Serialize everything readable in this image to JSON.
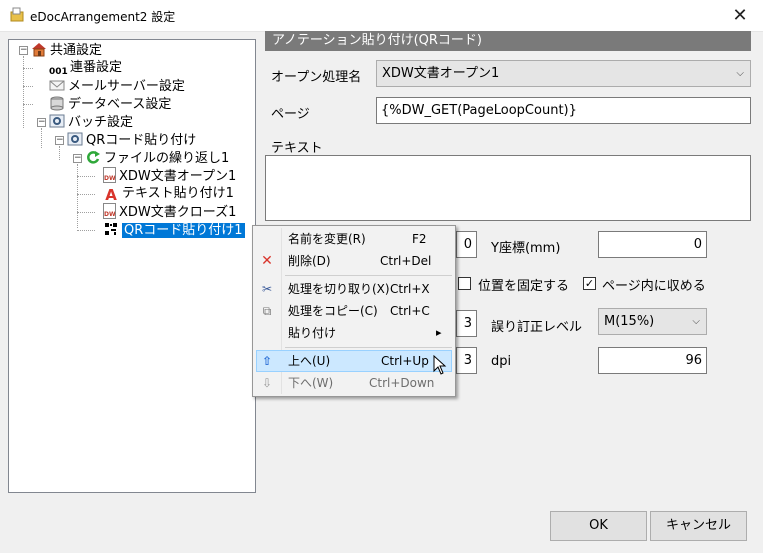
{
  "window": {
    "title": "eDocArrangement2 設定",
    "close_glyph": "✕"
  },
  "tree": {
    "items": [
      {
        "label": "共通設定",
        "icon": "house-icon"
      },
      {
        "label": "連番設定",
        "icon": "numbering-icon",
        "icon_text": "001"
      },
      {
        "label": "メールサーバー設定",
        "icon": "mail-icon"
      },
      {
        "label": "データベース設定",
        "icon": "database-icon"
      },
      {
        "label": "バッチ設定",
        "icon": "batch-icon"
      },
      {
        "label": "QRコード貼り付け",
        "icon": "qr-settings-icon"
      },
      {
        "label": "ファイルの繰り返し1",
        "icon": "loop-icon"
      },
      {
        "label": "XDW文書オープン1",
        "icon": "xdw-doc-icon",
        "icon_text": "DW"
      },
      {
        "label": "テキスト貼り付け1",
        "icon": "text-a-icon",
        "icon_text": "A"
      },
      {
        "label": "XDW文書クローズ1",
        "icon": "xdw-doc-icon",
        "icon_text": "DW"
      },
      {
        "label": "QRコード貼り付け1",
        "icon": "qr-code-icon"
      }
    ]
  },
  "panel": {
    "header": "アノテーション貼り付け(QRコード)",
    "open_process_label": "オープン処理名",
    "open_process_value": "XDW文書オープン1",
    "page_label": "ページ",
    "page_value": "{%DW_GET(PageLoopCount)}",
    "text_label": "テキスト",
    "text_value": "",
    "x_value": "0",
    "y_label": "Y座標(mm)",
    "y_value": "0",
    "fix_position_label": "位置を固定する",
    "fix_position_checked": false,
    "fit_page_label": "ページ内に収める",
    "fit_page_checked": true,
    "fit_page_check_glyph": "✓",
    "size_value": "3",
    "error_correction_label": "誤り訂正レベル",
    "error_correction_value": "M(15%)",
    "margin_value": "3",
    "dpi_label": "dpi",
    "dpi_value": "96"
  },
  "buttons": {
    "ok": "OK",
    "cancel": "キャンセル"
  },
  "context_menu": {
    "items": [
      {
        "label": "名前を変更(R)",
        "shortcut": "F2",
        "icon": ""
      },
      {
        "label": "削除(D)",
        "shortcut": "Ctrl+Del",
        "icon": "delete-x-icon",
        "glyph": "✕"
      },
      {
        "label": "処理を切り取り(X)",
        "shortcut": "Ctrl+X",
        "icon": "scissors-icon",
        "glyph": "✂"
      },
      {
        "label": "処理をコピー(C)",
        "shortcut": "Ctrl+C",
        "icon": "copy-icon",
        "glyph": "⧉"
      },
      {
        "label": "貼り付け",
        "shortcut": "",
        "icon": "",
        "submenu_glyph": "▸"
      },
      {
        "label": "上へ(U)",
        "shortcut": "Ctrl+Up",
        "icon": "up-arrow-icon",
        "glyph": "⇧"
      },
      {
        "label": "下へ(W)",
        "shortcut": "Ctrl+Down",
        "icon": "down-arrow-icon",
        "glyph": "⇩"
      }
    ]
  },
  "colors": {
    "selection": "#0078d7",
    "header_bg": "#7a7a7a",
    "menu_hover": "#cce8ff",
    "delete_icon": "#d9342b",
    "up_icon": "#2b6fd6"
  }
}
